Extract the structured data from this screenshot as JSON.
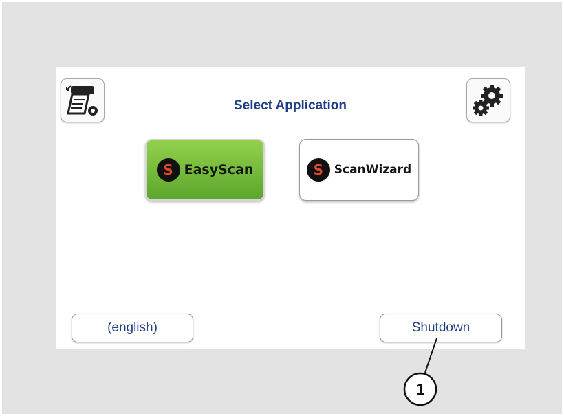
{
  "screen": {
    "title": "Select Application",
    "left_icon": "print-settings-icon",
    "right_icon": "gears-icon"
  },
  "apps": [
    {
      "label": "EasyScan",
      "logo_letter": "S",
      "icon": "easyscan-logo-icon",
      "selected": true
    },
    {
      "label": "ScanWizard",
      "logo_letter": "S",
      "icon": "scanwizard-logo-icon",
      "selected": false
    }
  ],
  "footer": {
    "language_label": "(english)",
    "shutdown_label": "Shutdown"
  },
  "callout": {
    "number": "1"
  },
  "colors": {
    "accent": "#1f3e85",
    "selected_green": "#6fb935",
    "logo_red": "#e2462a"
  }
}
